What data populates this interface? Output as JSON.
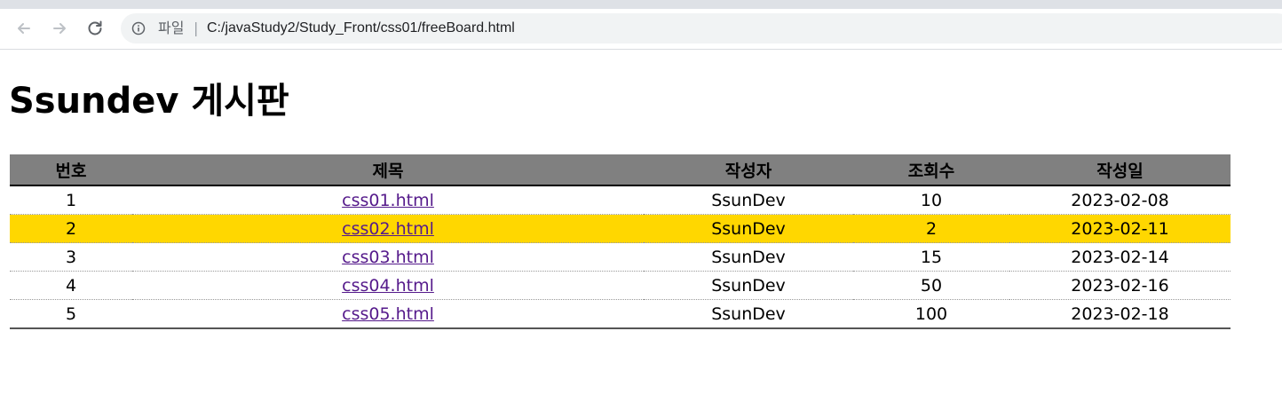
{
  "browser": {
    "tab_strip": "",
    "back_icon": "arrow-left-icon",
    "forward_icon": "arrow-right-icon",
    "reload_icon": "reload-icon",
    "info_icon": "info-icon",
    "scheme_label": "파일",
    "separator": "|",
    "url": "C:/javaStudy2/Study_Front/css01/freeBoard.html"
  },
  "page": {
    "title": "Ssundev 게시판"
  },
  "board": {
    "headers": [
      "번호",
      "제목",
      "작성자",
      "조회수",
      "작성일"
    ],
    "rows": [
      {
        "no": "1",
        "title": "css01.html",
        "author": "SsunDev",
        "views": "10",
        "date": "2023-02-08"
      },
      {
        "no": "2",
        "title": "css02.html",
        "author": "SsunDev",
        "views": "2",
        "date": "2023-02-11"
      },
      {
        "no": "3",
        "title": "css03.html",
        "author": "SsunDev",
        "views": "15",
        "date": "2023-02-14"
      },
      {
        "no": "4",
        "title": "css04.html",
        "author": "SsunDev",
        "views": "50",
        "date": "2023-02-16"
      },
      {
        "no": "5",
        "title": "css05.html",
        "author": "SsunDev",
        "views": "100",
        "date": "2023-02-18"
      }
    ],
    "highlight_color": "#ffd700",
    "header_color": "#808080",
    "link_color": "#551a8b"
  }
}
